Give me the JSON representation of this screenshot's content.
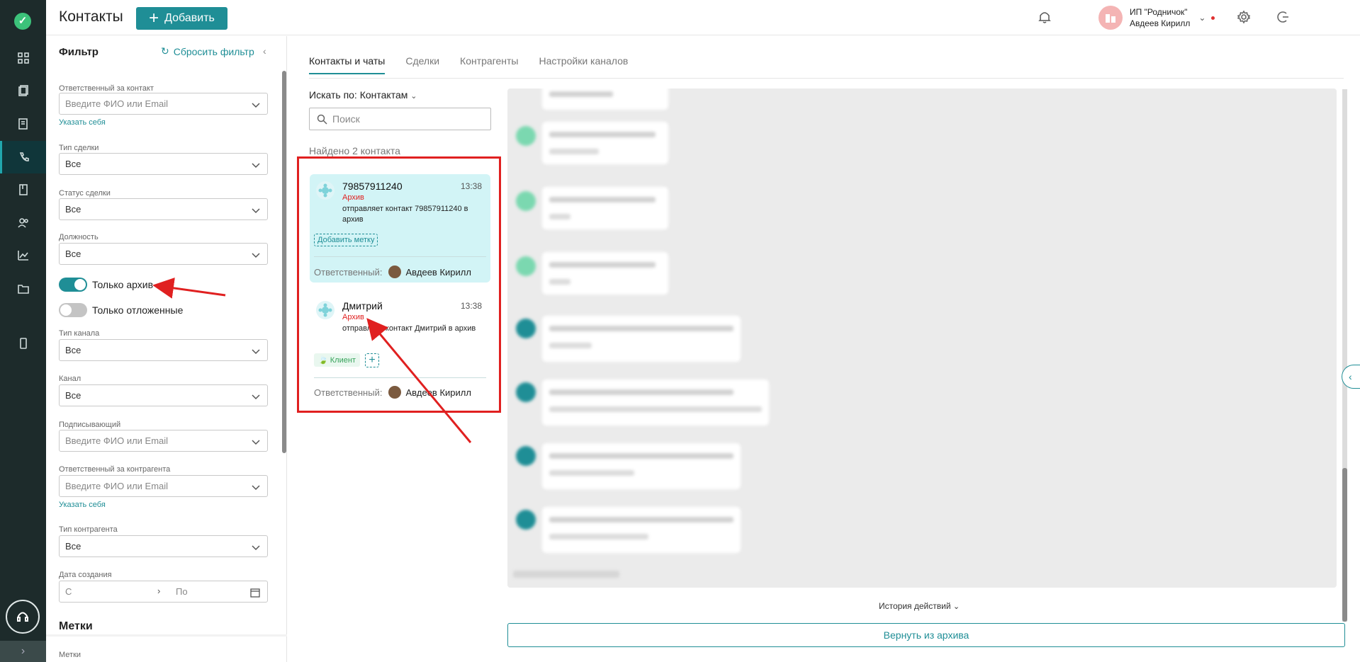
{
  "app": {
    "title": "Контакты",
    "add_button": "Добавить"
  },
  "org": {
    "line1": "ИП \"Родничок\"",
    "line2": "Авдеев Кирилл"
  },
  "filter": {
    "title": "Фильтр",
    "reset": "Сбросить фильтр",
    "fields": [
      {
        "label": "Ответственный за контакт",
        "value": "Введите ФИО или Email",
        "placeholder": true,
        "link": "Указать себя"
      },
      {
        "label": "Тип сделки",
        "value": "Все"
      },
      {
        "label": "Статус сделки",
        "value": "Все"
      },
      {
        "label": "Должность",
        "value": "Все"
      },
      {
        "label": "Тип канала",
        "value": "Все"
      },
      {
        "label": "Канал",
        "value": "Все"
      },
      {
        "label": "Подписывающий",
        "value": "Введите ФИО или Email",
        "placeholder": true
      },
      {
        "label": "Ответственный за контрагента",
        "value": "Введите ФИО или Email",
        "placeholder": true,
        "link": "Указать себя"
      },
      {
        "label": "Тип контрагента",
        "value": "Все"
      },
      {
        "label": "Дата создания",
        "from": "С",
        "to": "По"
      }
    ],
    "toggles": [
      {
        "label": "Только архив",
        "on": true
      },
      {
        "label": "Только отложенные",
        "on": false
      }
    ],
    "tags_section": "Метки",
    "tags_label": "Метки"
  },
  "tabs": [
    "Контакты и чаты",
    "Сделки",
    "Контрагенты",
    "Настройки каналов"
  ],
  "search": {
    "by": "Искать по: Контактам",
    "placeholder": "Поиск",
    "found": "Найдено 2 контакта"
  },
  "contacts": [
    {
      "name": "79857911240",
      "time": "13:38",
      "status": "Архив",
      "message": "отправляет контакт 79857911240 в архив",
      "tag_button": "Добавить метку",
      "responsible_label": "Ответственный:",
      "responsible": "Авдеев Кирилл"
    },
    {
      "name": "Дмитрий",
      "time": "13:38",
      "status": "Архив",
      "message": "отправляет контакт Дмитрий в архив",
      "tag": "Клиент",
      "tag_add": "+",
      "responsible_label": "Ответственный:",
      "responsible": "Авдеев Кирилл"
    }
  ],
  "chat": {
    "history": "История действий",
    "restore": "Вернуть из архива"
  },
  "colors": {
    "accent": "#1f8e96",
    "rail": "#1d2b2b",
    "archive": "#e02020",
    "selected_card": "#d2f4f6"
  }
}
